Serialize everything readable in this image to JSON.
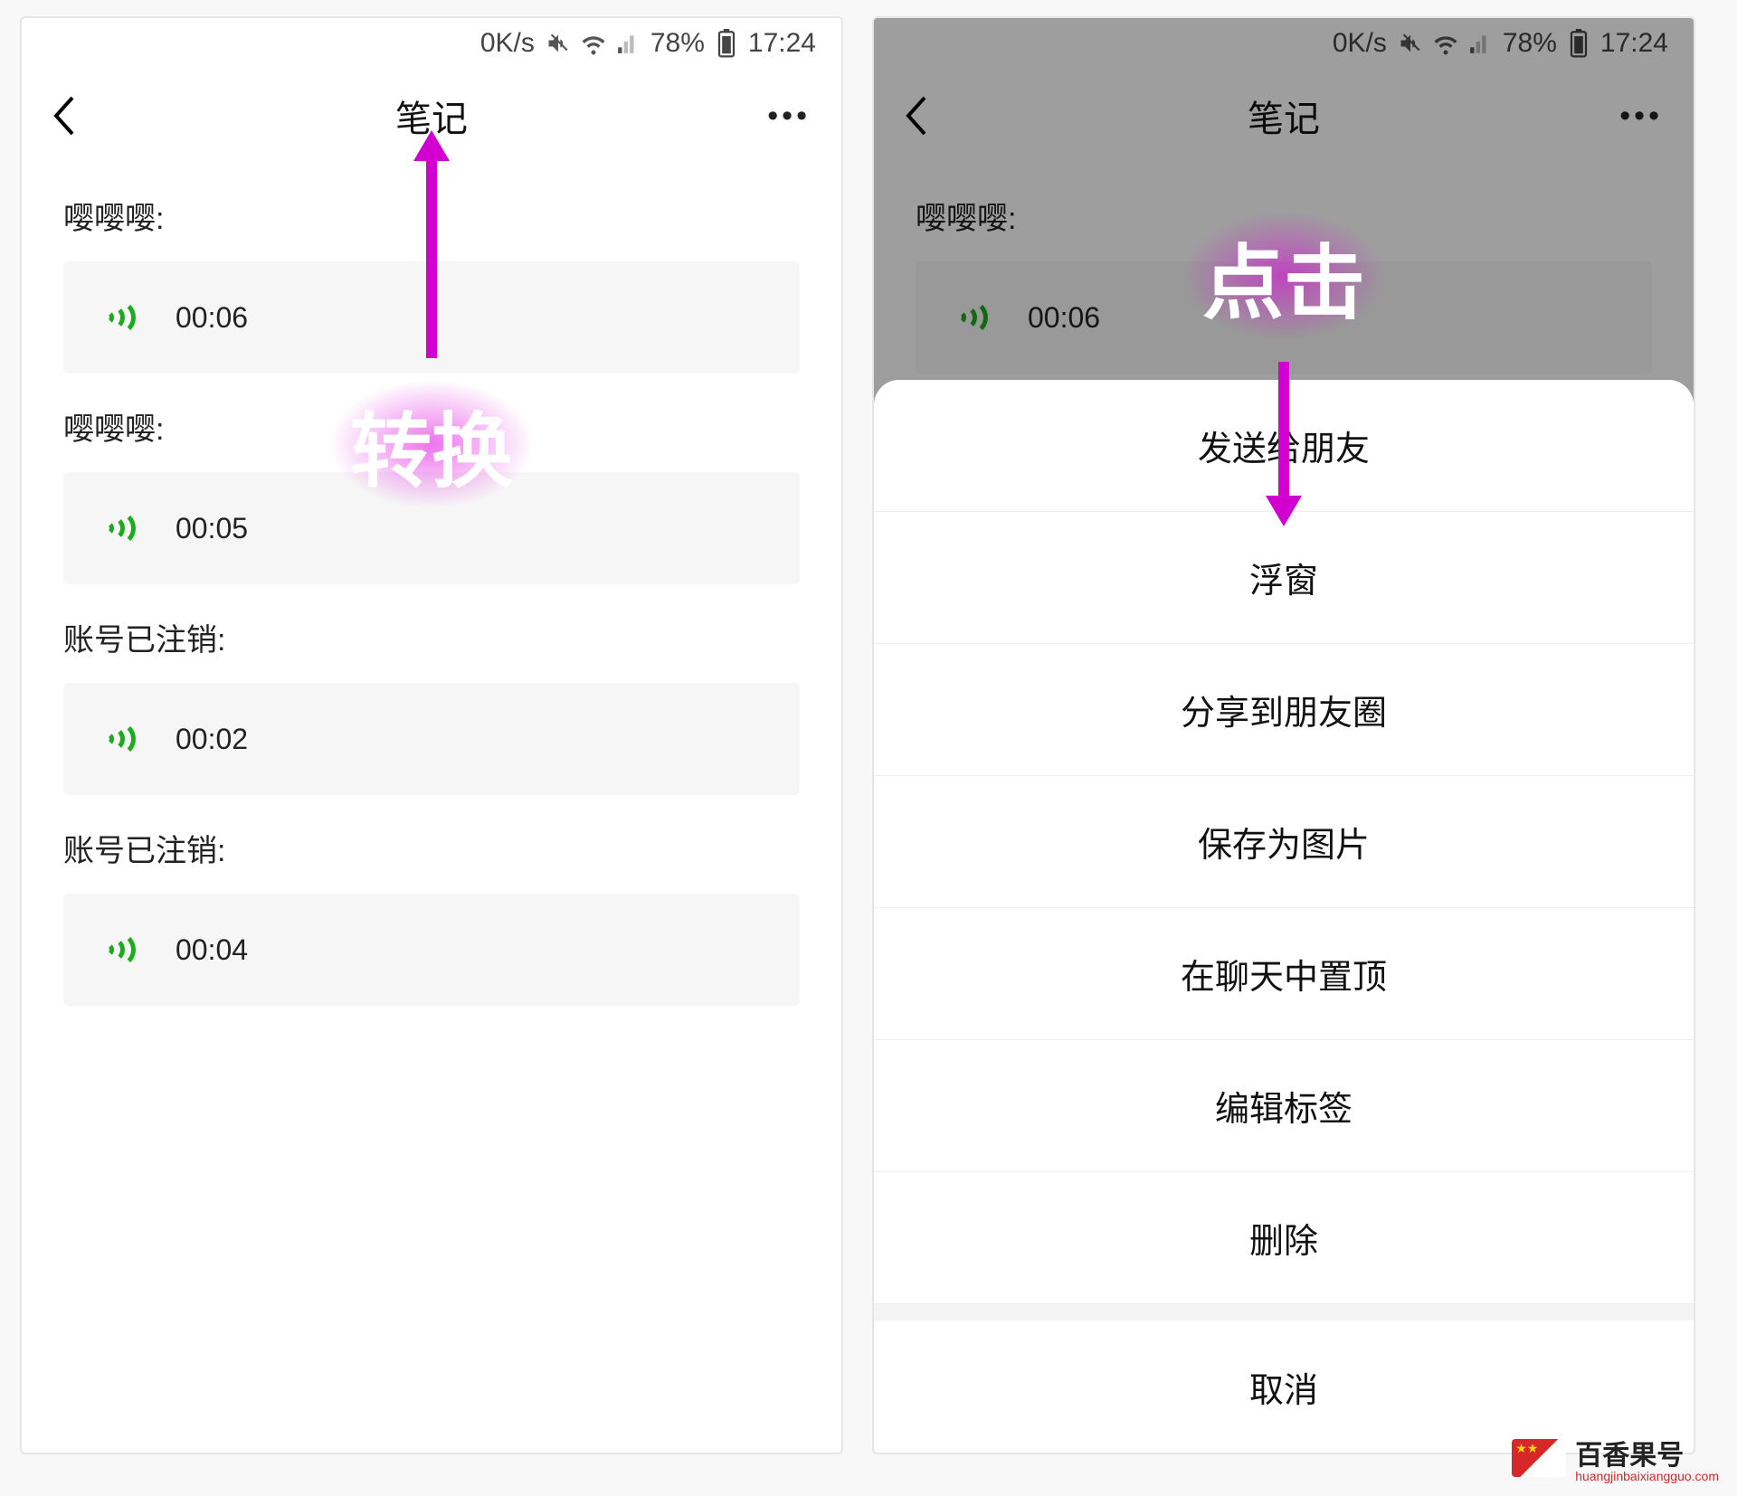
{
  "statusbar": {
    "speed": "0K/s",
    "battery_pct": "78%",
    "time": "17:24"
  },
  "nav": {
    "title": "笔记"
  },
  "notes": [
    {
      "sender": "嘤嘤嘤:",
      "duration": "00:06"
    },
    {
      "sender": "嘤嘤嘤:",
      "duration": "00:05"
    },
    {
      "sender": "账号已注销:",
      "duration": "00:02"
    },
    {
      "sender": "账号已注销:",
      "duration": "00:04"
    }
  ],
  "callout_left": "转换",
  "callout_right": "点击",
  "sheet": {
    "options": [
      "发送给朋友",
      "浮窗",
      "分享到朋友圈",
      "保存为图片",
      "在聊天中置顶",
      "编辑标签",
      "删除"
    ],
    "cancel": "取消"
  },
  "watermark": {
    "name": "百香果号",
    "domain": "huangjinbaixiangguo.com"
  }
}
